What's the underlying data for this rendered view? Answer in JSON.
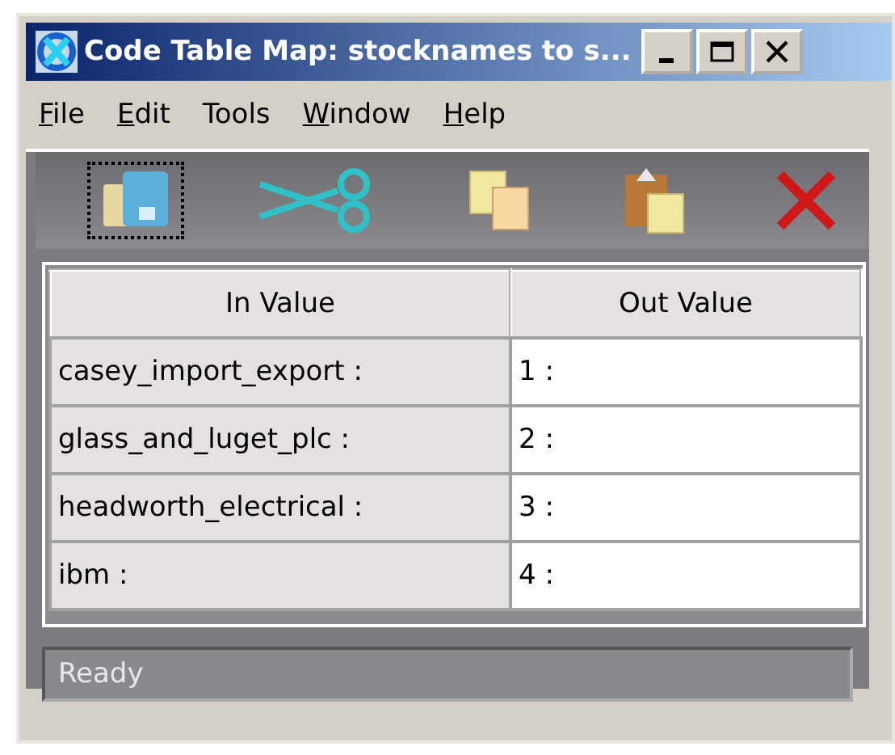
{
  "window": {
    "title": "Code Table Map: stocknames to s..."
  },
  "menu": [
    {
      "label": "File",
      "underlined": true
    },
    {
      "label": "Edit",
      "underlined": true
    },
    {
      "label": "Tools",
      "underlined": false
    },
    {
      "label": "Window",
      "underlined": true
    },
    {
      "label": "Help",
      "underlined": true
    }
  ],
  "toolbar": [
    {
      "kind": "open",
      "focused": true
    },
    {
      "kind": "cut",
      "focused": false
    },
    {
      "kind": "copy",
      "focused": false
    },
    {
      "kind": "paste",
      "focused": false
    },
    {
      "kind": "delete",
      "focused": false
    }
  ],
  "table": {
    "columns": [
      "In Value",
      "Out Value"
    ],
    "rows": [
      [
        "casey_import_export :",
        "1 :"
      ],
      [
        "glass_and_luget_plc :",
        "2 :"
      ],
      [
        "headworth_electrical :",
        "3 :"
      ],
      [
        "ibm :",
        "4 :"
      ]
    ]
  },
  "status_bar": "Ready"
}
